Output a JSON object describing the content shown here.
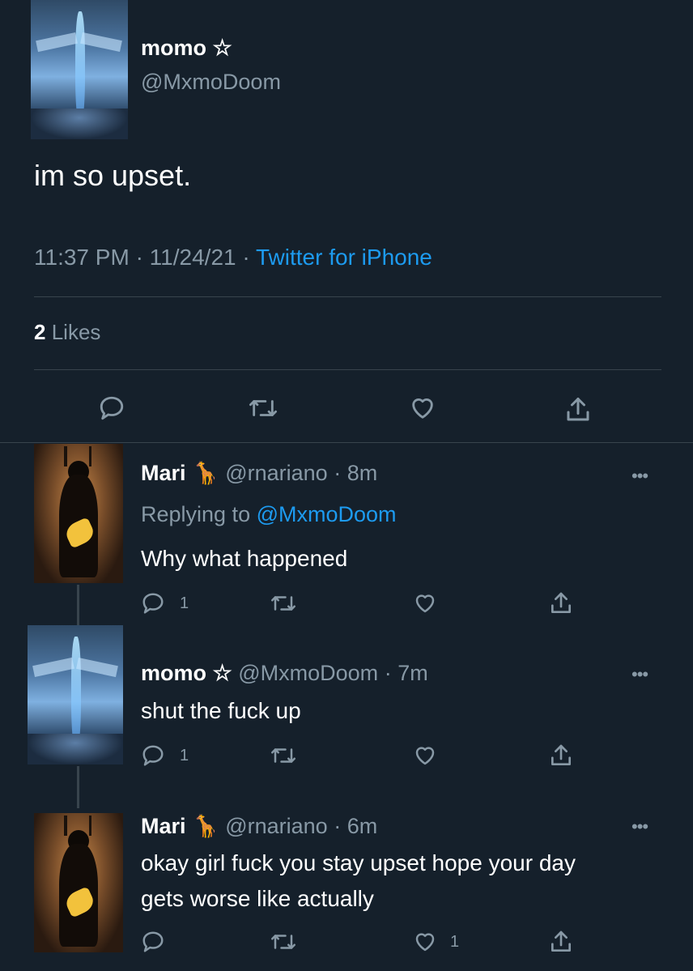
{
  "main_tweet": {
    "name": "momo ☆",
    "handle": "@MxmoDoom",
    "text": "im so upset.",
    "time": "11:37 PM",
    "sep1": "·",
    "date": "11/24/21",
    "sep2": "·",
    "source": "Twitter for iPhone",
    "likes_count": "2",
    "likes_label": "Likes"
  },
  "replies": [
    {
      "name": "Mari",
      "emoji": "🦒",
      "handle": "@rnariano",
      "time_sep": "·",
      "time": "8m",
      "replying_prefix": "Replying to",
      "replying_handle": "@MxmoDoom",
      "text": "Why what happened",
      "reply_count": "1",
      "like_count": ""
    },
    {
      "name": "momo ☆",
      "handle": "@MxmoDoom",
      "time_sep": "·",
      "time": "7m",
      "text": "shut the fuck up",
      "reply_count": "1",
      "like_count": ""
    },
    {
      "name": "Mari",
      "emoji": "🦒",
      "handle": "@rnariano",
      "time_sep": "·",
      "time": "6m",
      "text_line1": "okay girl fuck you stay upset hope your day",
      "text_line2": "gets worse like actually",
      "reply_count": "",
      "like_count": "1"
    }
  ],
  "more_label": "•••",
  "colors": {
    "background": "#15202b",
    "muted": "#8899a6",
    "link": "#1d9bf0",
    "divider": "#38444d"
  }
}
